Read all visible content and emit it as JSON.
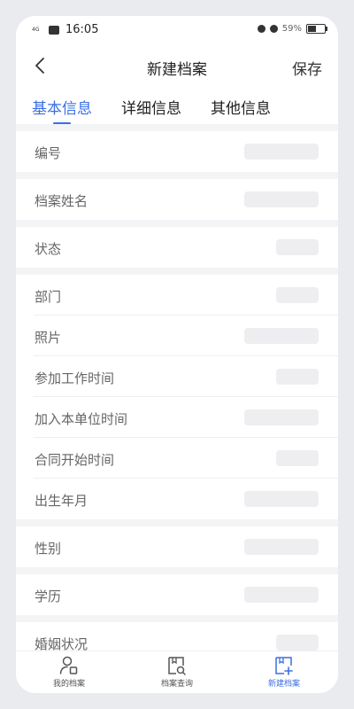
{
  "status_bar": {
    "time": "16:05",
    "network": "4G",
    "battery_text": "59%",
    "battery_level": 0.59
  },
  "header": {
    "title": "新建档案",
    "save_label": "保存"
  },
  "tabs": [
    {
      "label": "基本信息",
      "active": true
    },
    {
      "label": "详细信息",
      "active": false
    },
    {
      "label": "其他信息",
      "active": false
    }
  ],
  "form": {
    "field_number": "编号",
    "field_name": "档案姓名",
    "field_status": "状态",
    "field_department": "部门",
    "field_photo": "照片",
    "field_join_work": "参加工作时间",
    "field_join_unit": "加入本单位时间",
    "field_contract_start": "合同开始时间",
    "field_birth": "出生年月",
    "field_gender": "性别",
    "field_education": "学历",
    "field_marital": "婚姻状况"
  },
  "bottom_nav": {
    "my_archives": "我的档案",
    "archive_query": "档案查询",
    "new_archive": "新建档案"
  },
  "colors": {
    "accent": "#3b6fe4",
    "placeholder": "#eeeef1",
    "separator": "#f3f4f6"
  }
}
